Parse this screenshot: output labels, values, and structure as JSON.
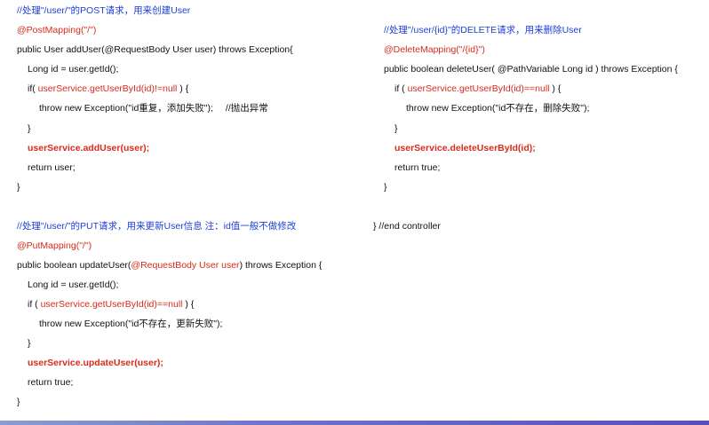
{
  "post_block": {
    "comment": "//处理\"/user/\"的POST请求，用来创建User",
    "annotation": "@PostMapping(\"/\")",
    "signature_pre": "public User addUser(",
    "signature_anno": "@RequestBody User user",
    "signature_post": ") throws Exception{",
    "line_id": "Long id = user.getId();",
    "if_pre": "if( ",
    "if_call": "userService.getUserById(id)!=null",
    "if_post": " ) {",
    "throw_line": "throw new Exception(\"id重复，添加失败\");",
    "throw_comment": "//抛出异常",
    "close_if": "}",
    "service_call": "userService.addUser(user);",
    "return_line": "return user;",
    "close_method": "}"
  },
  "delete_block": {
    "comment": "//处理\"/user/{id}\"的DELETE请求，用来删除User",
    "annotation": "@DeleteMapping(\"/{id}\")",
    "signature": "public boolean deleteUser( @PathVariable Long id ) throws Exception {",
    "if_pre": "if ( ",
    "if_call": "userService.getUserById(id)==null",
    "if_post": " ) {",
    "throw_line": "throw new Exception(\"id不存在，删除失败\");",
    "close_if": "}",
    "service_call": "userService.deleteUserById(id);",
    "return_line": "return true;",
    "close_method": "}"
  },
  "put_block": {
    "comment": "//处理\"/user/\"的PUT请求，用来更新User信息   注：id值一般不做修改",
    "annotation": "@PutMapping(\"/\")",
    "signature_pre": "public boolean updateUser(",
    "signature_anno": "@RequestBody User user",
    "signature_post": ") throws Exception {",
    "line_id": "Long id = user.getId();",
    "if_pre": "if ( ",
    "if_call": "userService.getUserById(id)==null",
    "if_post": " ) {",
    "throw_line": "throw new Exception(\"id不存在，更新失败\");",
    "close_if": "}",
    "service_call": "userService.updateUser(user);",
    "return_line": "return true;",
    "close_method": "}"
  },
  "end_controller": "} //end controller"
}
